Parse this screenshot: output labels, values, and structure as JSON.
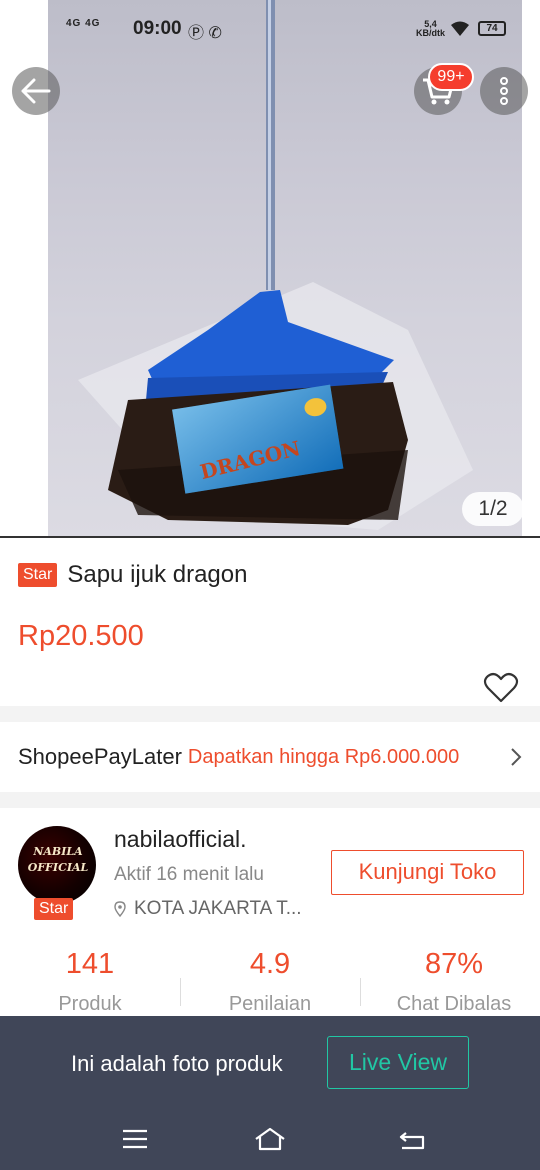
{
  "status_bar": {
    "network": "4G 4G",
    "time": "09:00",
    "speed_value": "5,4",
    "speed_unit": "KB/dtk",
    "battery": "74"
  },
  "hero": {
    "cart_badge": "99+",
    "image_counter": "1/2",
    "image_text": "DRAGON"
  },
  "product": {
    "badge": "Star",
    "title": "Sapu ijuk dragon",
    "price": "Rp20.500"
  },
  "paylater": {
    "name": "ShopeePayLater",
    "offer": "Dapatkan hingga Rp6.000.000"
  },
  "shop": {
    "avatar_text": "NABILA OFFICIAL",
    "badge": "Star",
    "name": "nabilaofficial.",
    "active": "Aktif 16 menit lalu",
    "location": "KOTA JAKARTA T...",
    "visit_label": "Kunjungi Toko",
    "stats": [
      {
        "value": "141",
        "label": "Produk"
      },
      {
        "value": "4.9",
        "label": "Penilaian"
      },
      {
        "value": "87%",
        "label": "Chat Dibalas"
      }
    ]
  },
  "live_overlay": {
    "text": "Ini adalah foto produk",
    "button": "Live View"
  },
  "colors": {
    "accent": "#ee4d2d",
    "live_accent": "#21c7a4",
    "overlay_bg": "#404658"
  }
}
